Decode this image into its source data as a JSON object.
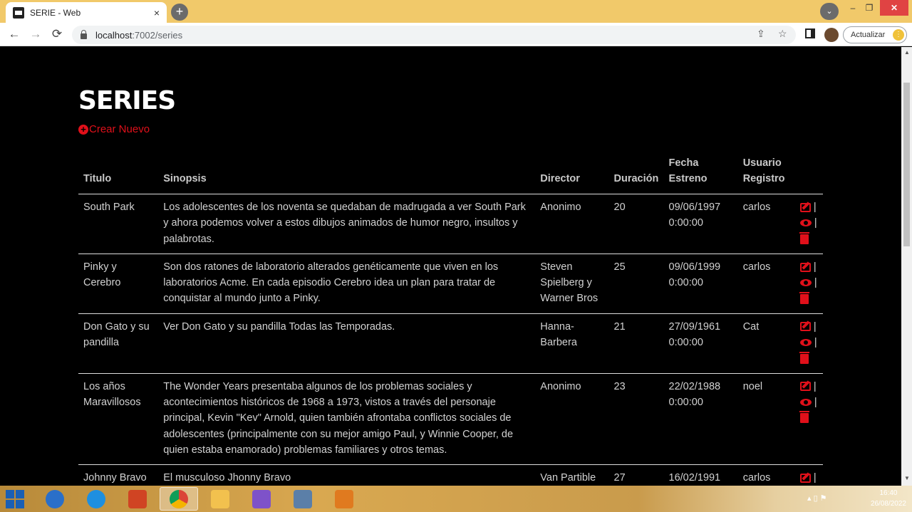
{
  "browser": {
    "tab_title": "SERIE - Web",
    "tab_close": "×",
    "new_tab": "+",
    "url_host": "localhost",
    "url_path": ":7002/series",
    "update_label": "Actualizar",
    "update_dots": "⋮",
    "back": "←",
    "forward": "→",
    "reload": "⟳",
    "share": "⇪",
    "star": "☆",
    "tab_search": "⌄",
    "minimize": "–",
    "restore": "❐",
    "close_window": "✕"
  },
  "page": {
    "title": "SERIES",
    "create_label": "Crear Nuevo",
    "create_icon": "+"
  },
  "table": {
    "headers": {
      "titulo": "Titulo",
      "sinopsis": "Sinopsis",
      "director": "Director",
      "duracion": "Duración",
      "fecha": "Fecha Estreno",
      "usuario": "Usuario Registro"
    },
    "action_sep": "|",
    "rows": [
      {
        "titulo": "South Park",
        "sinopsis": "Los adolescentes de los noventa se quedaban de madrugada a ver South Park y ahora podemos volver a estos dibujos animados de humor negro, insultos y palabrotas.",
        "director": "Anonimo",
        "duracion": "20",
        "fecha": "09/06/1997 0:00:00",
        "usuario": "carlos"
      },
      {
        "titulo": "Pinky y Cerebro",
        "sinopsis": "Son dos ratones de laboratorio alterados genéticamente que viven en los laboratorios Acme. En cada episodio Cerebro idea un plan para tratar de conquistar al mundo junto a Pinky.",
        "director": "Steven Spielberg y Warner Bros",
        "duracion": "25",
        "fecha": "09/06/1999 0:00:00",
        "usuario": "carlos"
      },
      {
        "titulo": "Don Gato y su pandilla",
        "sinopsis": "Ver Don Gato y su pandilla Todas las Temporadas.",
        "director": "Hanna-Barbera",
        "duracion": "21",
        "fecha": "27/09/1961 0:00:00",
        "usuario": "Cat"
      },
      {
        "titulo": "Los años Maravillosos",
        "sinopsis": "The Wonder Years presentaba algunos de los problemas sociales y acontecimientos históricos de 1968 a 1973, vistos a través del personaje principal, Kevin \"Kev\" Arnold, quien también afrontaba conflictos sociales de adolescentes (principalmente con su mejor amigo Paul, y Winnie Cooper, de quien estaba enamorado) problemas familiares y otros temas.",
        "director": "Anonimo",
        "duracion": "23",
        "fecha": "22/02/1988 0:00:00",
        "usuario": "noel"
      },
      {
        "titulo": "Johnny Bravo",
        "sinopsis": "El musculoso Jhonny Bravo",
        "director": "Van Partible",
        "duracion": "27",
        "fecha": "16/02/1991",
        "usuario": "carlos"
      }
    ]
  },
  "taskbar": {
    "time": "16:40",
    "date": "26/08/2022",
    "tray_icons": "▴ ▯ ⚑"
  },
  "colors": {
    "accent": "#e0101a",
    "tabbar": "#f1c96a",
    "page_bg": "#000000"
  }
}
